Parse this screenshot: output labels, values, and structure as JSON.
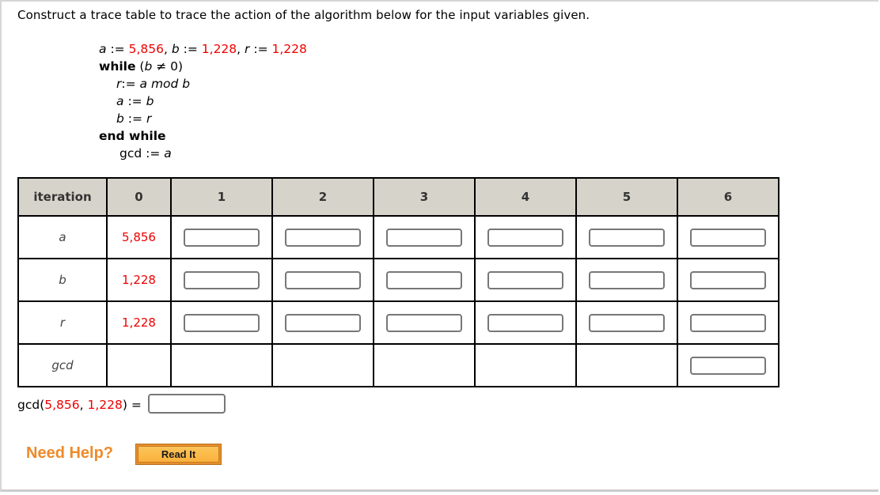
{
  "prompt": "Construct a trace table to trace the action of the algorithm below for the input variables given.",
  "algorithm": {
    "init": {
      "a_var": "a",
      "a_value": "5,856",
      "b_var": "b",
      "b_value": "1,228",
      "r_var": "r",
      "r_value": "1,228",
      "assign": ":=",
      "sep": ","
    },
    "while_keyword": "while",
    "while_condition_var": "b",
    "while_condition_rest": "≠ 0)",
    "body": [
      {
        "lhs": "r",
        "op": ":=",
        "rhs": "a mod b"
      },
      {
        "lhs": "a",
        "op": ":=",
        "rhs": "b"
      },
      {
        "lhs": "b",
        "op": ":=",
        "rhs": "r"
      }
    ],
    "end_keyword": "end while",
    "final": {
      "lhs": "gcd",
      "op": ":=",
      "rhs": "a"
    }
  },
  "trace_table": {
    "header_label": "iteration",
    "iterations": [
      "0",
      "1",
      "2",
      "3",
      "4",
      "5",
      "6"
    ],
    "rows": [
      {
        "label": "a",
        "initial": "5,856",
        "inputs": [
          "",
          "",
          "",
          "",
          "",
          ""
        ]
      },
      {
        "label": "b",
        "initial": "1,228",
        "inputs": [
          "",
          "",
          "",
          "",
          "",
          ""
        ]
      },
      {
        "label": "r",
        "initial": "1,228",
        "inputs": [
          "",
          "",
          "",
          "",
          "",
          ""
        ]
      },
      {
        "label": "gcd",
        "initial": "",
        "inputs_only_last": ""
      }
    ]
  },
  "answer": {
    "prefix": "gcd(",
    "arg1": "5,856",
    "comma": ", ",
    "arg2": "1,228",
    "suffix": ") =",
    "value": ""
  },
  "help": {
    "label": "Need Help?",
    "read_it_button": "Read It"
  },
  "colors": {
    "given_value": "#ee0000",
    "header_bg": "#d6d3ca",
    "help_orange": "#ee8a2a",
    "button_orange": "#fab13c"
  }
}
